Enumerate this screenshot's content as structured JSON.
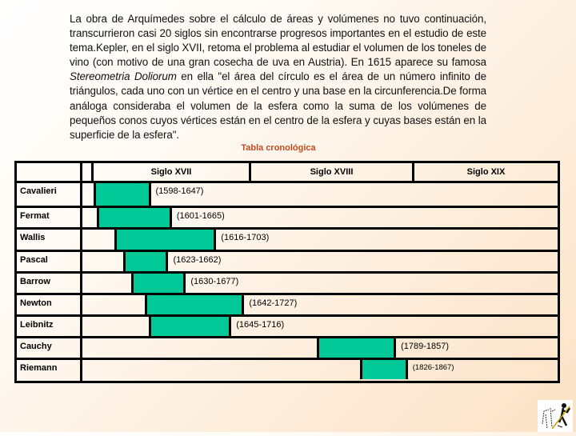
{
  "paragraph": {
    "part1": "La obra de Arquímedes sobre el cálculo de áreas y volúmenes no tuvo continuación, transcurrieron casi 20 siglos sin encontrarse progresos importantes en el estudio de este tema.Kepler, en el siglo XVII, retoma el problema al estudiar el volumen de los toneles de vino (con motivo de una gran cosecha de uva en Austria). En  1615 aparece su famosa ",
    "italic": "Stereometria Doliorum",
    "part2": " en ella \"el área del círculo es el área de un número infinito de triángulos, cada uno con un vértice en el centro y una base en la circunferencia.De forma análoga consideraba el volumen de la esfera como la suma de los volúmenes de pequeños conos cuyos vértices están en el centro de la esfera y cuyas bases están en la superficie de la esfera\"."
  },
  "table": {
    "title": "Tabla cronológica",
    "centuries": [
      "Siglo XVII",
      "Siglo XVIII",
      "Siglo XIX"
    ],
    "rows": [
      {
        "name": "Cavalieri",
        "range": "(1598-1647)",
        "birth": 1598,
        "death": 1647
      },
      {
        "name": "Fermat",
        "range": "(1601-1665)",
        "birth": 1601,
        "death": 1665
      },
      {
        "name": "Wallis",
        "range": "(1616-1703)",
        "birth": 1616,
        "death": 1703
      },
      {
        "name": "Pascal",
        "range": "(1623-1662)",
        "birth": 1623,
        "death": 1662
      },
      {
        "name": "Barrow",
        "range": "(1630-1677)",
        "birth": 1630,
        "death": 1677
      },
      {
        "name": "Newton",
        "range": "(1642-1727)",
        "birth": 1642,
        "death": 1727
      },
      {
        "name": "Leibnitz",
        "range": "(1645-1716)",
        "birth": 1645,
        "death": 1716
      },
      {
        "name": "Cauchy",
        "range": "(1789-1857)",
        "birth": 1789,
        "death": 1857
      },
      {
        "name": "Riemann",
        "range": "(1826-1867)",
        "birth": 1826,
        "death": 1867
      }
    ]
  },
  "colors": {
    "bar": "#00c896",
    "title": "#c24a1c"
  },
  "logo": {
    "icon": "archimedes-drawing-clipart-icon"
  }
}
